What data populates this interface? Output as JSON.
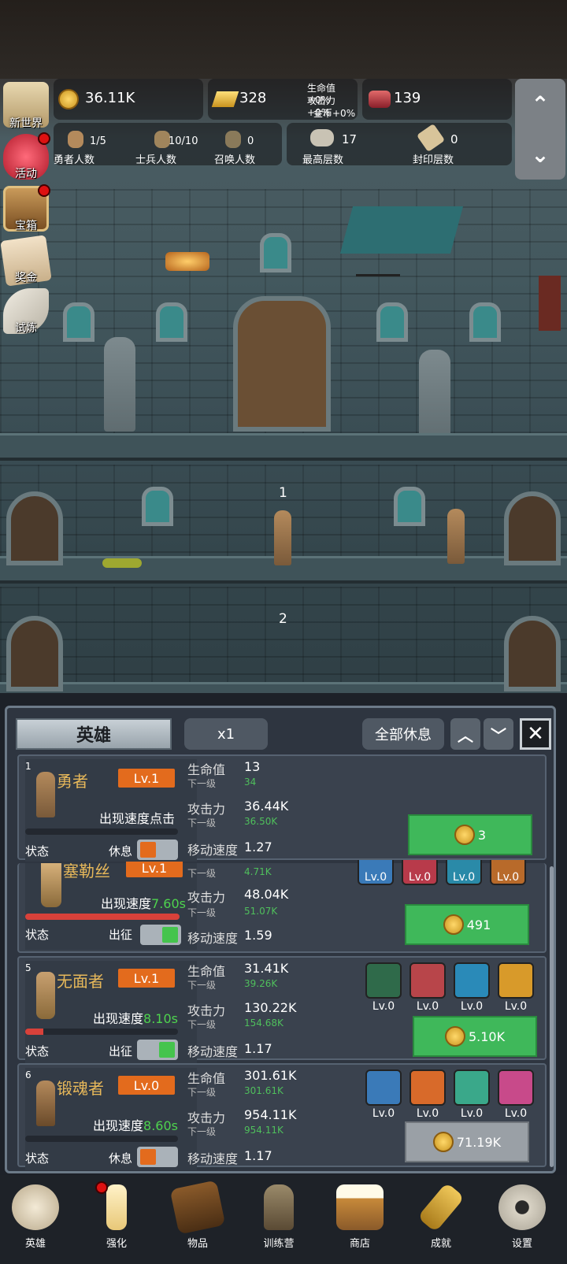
{
  "hud": {
    "gold": "36.11K",
    "gold_bars": "328",
    "bonus_lines": [
      "生命值+0%",
      "攻击力+0%",
      "金币+0%"
    ],
    "meat": "139",
    "hero_count": "1/5",
    "hero_count_label": "勇者人数",
    "soldier_count": "10/10",
    "soldier_count_label": "士兵人数",
    "summon_count": "0",
    "summon_count_label": "召唤人数",
    "max_floor": "17",
    "max_floor_label": "最高层数",
    "seal_floor": "0",
    "seal_floor_label": "封印层数"
  },
  "side_menu": [
    {
      "label": "新世界",
      "icon": "map-scroll-icon",
      "dot": false
    },
    {
      "label": "活动",
      "icon": "heart-icon",
      "dot": true
    },
    {
      "label": "宝箱",
      "icon": "treasure-chest-icon",
      "dot": true
    },
    {
      "label": "奖金",
      "icon": "envelope-icon",
      "dot": false
    },
    {
      "label": "试炼",
      "icon": "feather-icon",
      "dot": false
    }
  ],
  "floors": [
    "1",
    "2"
  ],
  "panel": {
    "tab": "英雄",
    "speed": "x1",
    "rest_all": "全部休息"
  },
  "heroes": [
    {
      "num": "1",
      "name": "勇者",
      "level": "Lv.1",
      "speed_text": "出现速度点击",
      "speed_val": "",
      "state_label": "状态",
      "state": "休息",
      "bar": 0,
      "hp_label": "生命值",
      "hp": "13",
      "hp_next_label": "下一级",
      "hp_next": "34",
      "atk_label": "攻击力",
      "atk": "36.44K",
      "atk_next_label": "下一级",
      "atk_next": "36.50K",
      "move_label": "移动速度",
      "move": "1.27",
      "cost": "3",
      "equip": []
    },
    {
      "num": "",
      "name": "塞勒丝",
      "level": "Lv.1",
      "speed_text": "出现速度",
      "speed_val": "7.60s",
      "state_label": "状态",
      "state": "出征",
      "bar": 1,
      "hp_next_label": "下一级",
      "hp_next": "4.71K",
      "atk_label": "攻击力",
      "atk": "48.04K",
      "atk_next_label": "下一级",
      "atk_next": "51.07K",
      "move_label": "移动速度",
      "move": "1.59",
      "cost": "491",
      "equip": [
        "Lv.0",
        "Lv.0",
        "Lv.0",
        "Lv.0"
      ]
    },
    {
      "num": "5",
      "name": "无面者",
      "level": "Lv.1",
      "speed_text": "出现速度",
      "speed_val": "8.10s",
      "state_label": "状态",
      "state": "出征",
      "bar": 0.12,
      "hp_label": "生命值",
      "hp": "31.41K",
      "hp_next_label": "下一级",
      "hp_next": "39.26K",
      "atk_label": "攻击力",
      "atk": "130.22K",
      "atk_next_label": "下一级",
      "atk_next": "154.68K",
      "move_label": "移动速度",
      "move": "1.17",
      "cost": "5.10K",
      "equip": [
        "Lv.0",
        "Lv.0",
        "Lv.0",
        "Lv.0"
      ]
    },
    {
      "num": "6",
      "name": "锻魂者",
      "level": "Lv.0",
      "speed_text": "出现速度",
      "speed_val": "8.60s",
      "state_label": "状态",
      "state": "休息",
      "bar": 0,
      "hp_label": "生命值",
      "hp": "301.61K",
      "hp_next_label": "下一级",
      "hp_next": "301.61K",
      "atk_label": "攻击力",
      "atk": "954.11K",
      "atk_next_label": "下一级",
      "atk_next": "954.11K",
      "move_label": "移动速度",
      "move": "1.17",
      "cost": "71.19K",
      "equip": [
        "Lv.0",
        "Lv.0",
        "Lv.0",
        "Lv.0"
      ]
    }
  ],
  "nav": [
    {
      "label": "英雄",
      "icon": "skull-icon"
    },
    {
      "label": "强化",
      "icon": "candle-icon"
    },
    {
      "label": "物品",
      "icon": "book-icon"
    },
    {
      "label": "训练营",
      "icon": "lantern-icon"
    },
    {
      "label": "商店",
      "icon": "beer-mug-icon"
    },
    {
      "label": "成就",
      "icon": "key-icon"
    },
    {
      "label": "设置",
      "icon": "gear-icon"
    }
  ],
  "colors": {
    "accent_orange": "#e36b1d",
    "buy_green": "#3fb85a",
    "value_green": "#4fbf5c",
    "name_gold": "#e7b85a"
  }
}
